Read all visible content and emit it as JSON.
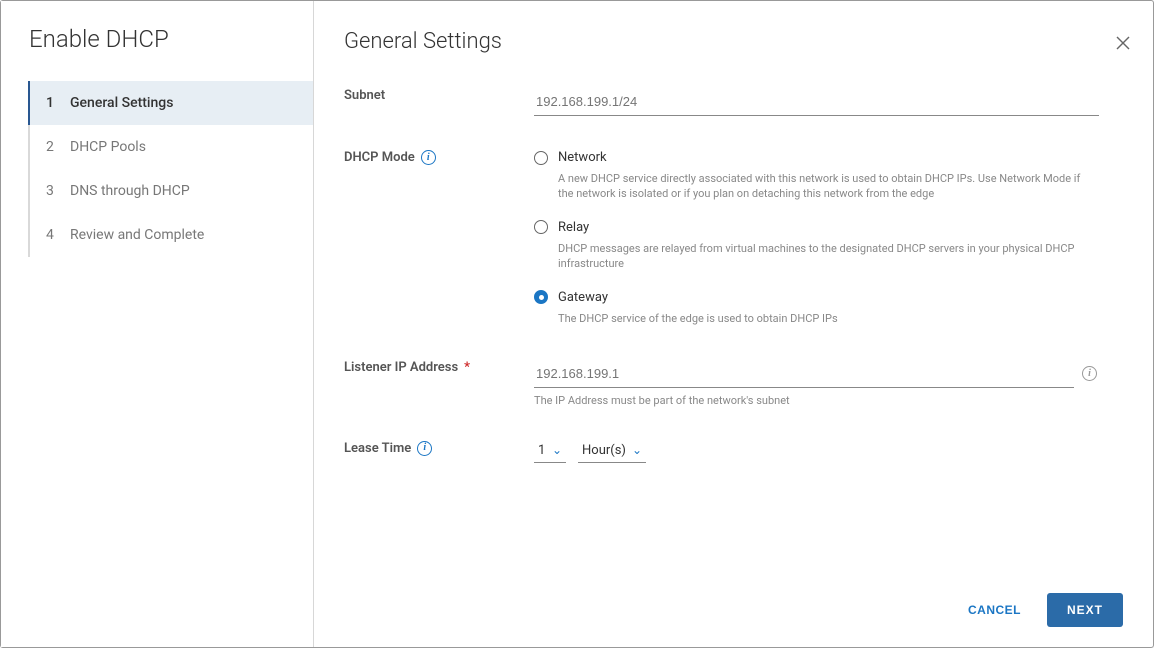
{
  "sidebar": {
    "title": "Enable DHCP",
    "steps": [
      {
        "num": "1",
        "label": "General Settings"
      },
      {
        "num": "2",
        "label": "DHCP Pools"
      },
      {
        "num": "3",
        "label": "DNS through DHCP"
      },
      {
        "num": "4",
        "label": "Review and Complete"
      }
    ]
  },
  "main": {
    "title": "General Settings",
    "subnet": {
      "label": "Subnet",
      "placeholder": "192.168.199.1/24"
    },
    "dhcp_mode": {
      "label": "DHCP Mode",
      "options": [
        {
          "label": "Network",
          "desc": "A new DHCP service directly associated with this network is used to obtain DHCP IPs. Use Network Mode if the network is isolated or if you plan on detaching this network from the edge"
        },
        {
          "label": "Relay",
          "desc": "DHCP messages are relayed from virtual machines to the designated DHCP servers in your physical DHCP infrastructure"
        },
        {
          "label": "Gateway",
          "desc": "The DHCP service of the edge is used to obtain DHCP IPs"
        }
      ],
      "selected": "Gateway"
    },
    "listener": {
      "label": "Listener IP Address",
      "placeholder": "192.168.199.1",
      "helper": "The IP Address must be part of the network's subnet"
    },
    "lease": {
      "label": "Lease Time",
      "value": "1",
      "unit": "Hour(s)"
    }
  },
  "footer": {
    "cancel": "CANCEL",
    "next": "NEXT"
  }
}
